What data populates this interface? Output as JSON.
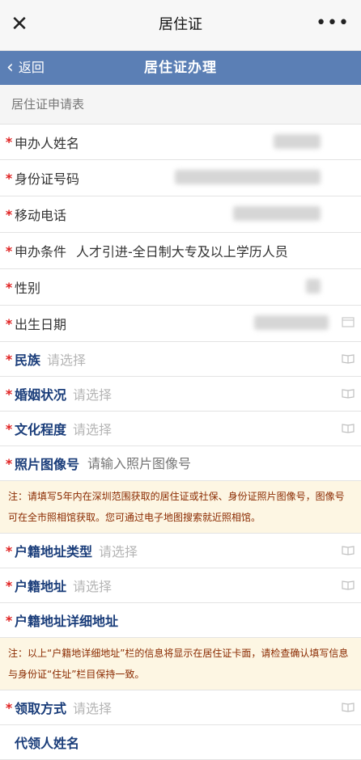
{
  "topbar": {
    "title": "居住证",
    "close_icon": "close-icon",
    "more_icon": "more-icon"
  },
  "navbar": {
    "back_label": "返回",
    "title": "居住证办理"
  },
  "section_title": "居住证申请表",
  "fields": {
    "applicant_name": {
      "label": "申办人姓名"
    },
    "id_number": {
      "label": "身份证号码"
    },
    "mobile": {
      "label": "移动电话"
    },
    "condition": {
      "label": "申办条件",
      "value": "人才引进-全日制大专及以上学历人员"
    },
    "gender": {
      "label": "性别"
    },
    "birth_date": {
      "label": "出生日期"
    },
    "ethnicity": {
      "label": "民族",
      "placeholder": "请选择"
    },
    "marital": {
      "label": "婚姻状况",
      "placeholder": "请选择"
    },
    "education": {
      "label": "文化程度",
      "placeholder": "请选择"
    },
    "photo_number": {
      "label": "照片图像号",
      "placeholder": "请输入照片图像号"
    },
    "household_type": {
      "label": "户籍地址类型",
      "placeholder": "请选择"
    },
    "household_address": {
      "label": "户籍地址",
      "placeholder": "请选择"
    },
    "household_detail": {
      "label": "户籍地址详细地址"
    },
    "pickup": {
      "label": "领取方式",
      "placeholder": "请选择"
    },
    "proxy_name": {
      "label": "代领人姓名"
    }
  },
  "notes": {
    "photo_note": "注：请填写5年内在深圳范围获取的居住证或社保、身份证照片图像号，图像号可在全市照相馆获取。您可通过电子地图搜索就近照相馆。",
    "address_note": "注：以上“户籍地详细地址”栏的信息将显示在居住证卡面，请检查确认填写信息与身份证“住址”栏目保持一致。"
  },
  "required_mark": "*",
  "colors": {
    "nav_blue": "#5b7fb5",
    "required_red": "#e02020",
    "label_blue": "#1a3d7a"
  }
}
